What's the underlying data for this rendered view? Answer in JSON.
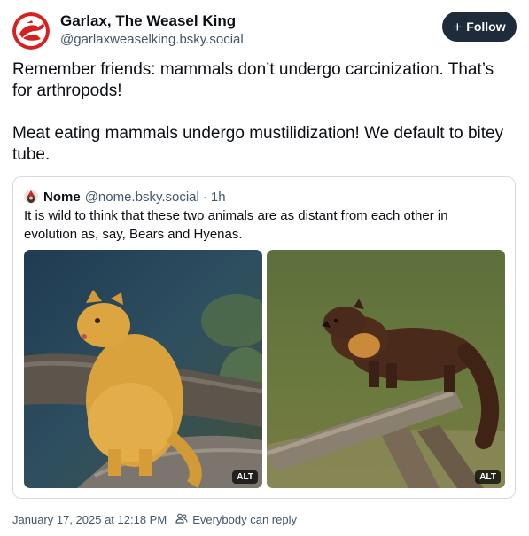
{
  "author": {
    "display_name": "Garlax, The Weasel King",
    "handle": "@garlaxweaselking.bsky.social",
    "avatar_icon": "weasel-logo-avatar"
  },
  "follow_button": {
    "label": "Follow",
    "icon": "plus-icon"
  },
  "post": {
    "paragraph_1": "Remember friends: mammals don’t undergo carcinization. That’s for arthropods!",
    "paragraph_2": "Meat eating mammals undergo mustilidization! We default to bitey tube."
  },
  "quote": {
    "display_name": "Nome",
    "handle": "@nome.bsky.social",
    "separator": "·",
    "time": "1h",
    "text": "It is wild to think that these two animals are as distant from each other in evolution as, say, Bears and Hyenas.",
    "images": [
      {
        "alt_label": "ALT"
      },
      {
        "alt_label": "ALT"
      }
    ]
  },
  "footer": {
    "timestamp": "January 17, 2025 at 12:18 PM",
    "reply_setting": "Everybody can reply",
    "reply_icon": "people-icon"
  }
}
